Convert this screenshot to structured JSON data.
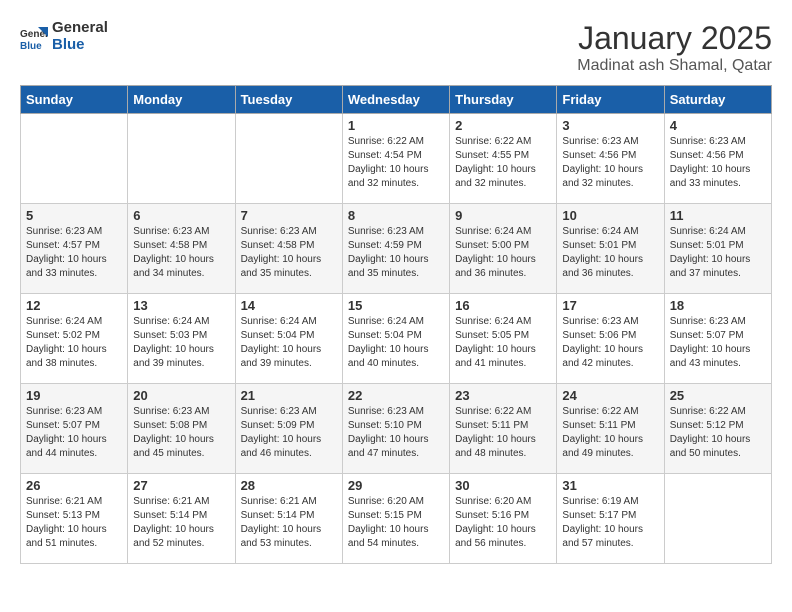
{
  "app": {
    "logo_line1": "General",
    "logo_line2": "Blue"
  },
  "header": {
    "month": "January 2025",
    "location": "Madinat ash Shamal, Qatar"
  },
  "weekdays": [
    "Sunday",
    "Monday",
    "Tuesday",
    "Wednesday",
    "Thursday",
    "Friday",
    "Saturday"
  ],
  "weeks": [
    [
      {
        "day": "",
        "sunrise": "",
        "sunset": "",
        "daylight": ""
      },
      {
        "day": "",
        "sunrise": "",
        "sunset": "",
        "daylight": ""
      },
      {
        "day": "",
        "sunrise": "",
        "sunset": "",
        "daylight": ""
      },
      {
        "day": "1",
        "sunrise": "Sunrise: 6:22 AM",
        "sunset": "Sunset: 4:54 PM",
        "daylight": "Daylight: 10 hours and 32 minutes."
      },
      {
        "day": "2",
        "sunrise": "Sunrise: 6:22 AM",
        "sunset": "Sunset: 4:55 PM",
        "daylight": "Daylight: 10 hours and 32 minutes."
      },
      {
        "day": "3",
        "sunrise": "Sunrise: 6:23 AM",
        "sunset": "Sunset: 4:56 PM",
        "daylight": "Daylight: 10 hours and 32 minutes."
      },
      {
        "day": "4",
        "sunrise": "Sunrise: 6:23 AM",
        "sunset": "Sunset: 4:56 PM",
        "daylight": "Daylight: 10 hours and 33 minutes."
      }
    ],
    [
      {
        "day": "5",
        "sunrise": "Sunrise: 6:23 AM",
        "sunset": "Sunset: 4:57 PM",
        "daylight": "Daylight: 10 hours and 33 minutes."
      },
      {
        "day": "6",
        "sunrise": "Sunrise: 6:23 AM",
        "sunset": "Sunset: 4:58 PM",
        "daylight": "Daylight: 10 hours and 34 minutes."
      },
      {
        "day": "7",
        "sunrise": "Sunrise: 6:23 AM",
        "sunset": "Sunset: 4:58 PM",
        "daylight": "Daylight: 10 hours and 35 minutes."
      },
      {
        "day": "8",
        "sunrise": "Sunrise: 6:23 AM",
        "sunset": "Sunset: 4:59 PM",
        "daylight": "Daylight: 10 hours and 35 minutes."
      },
      {
        "day": "9",
        "sunrise": "Sunrise: 6:24 AM",
        "sunset": "Sunset: 5:00 PM",
        "daylight": "Daylight: 10 hours and 36 minutes."
      },
      {
        "day": "10",
        "sunrise": "Sunrise: 6:24 AM",
        "sunset": "Sunset: 5:01 PM",
        "daylight": "Daylight: 10 hours and 36 minutes."
      },
      {
        "day": "11",
        "sunrise": "Sunrise: 6:24 AM",
        "sunset": "Sunset: 5:01 PM",
        "daylight": "Daylight: 10 hours and 37 minutes."
      }
    ],
    [
      {
        "day": "12",
        "sunrise": "Sunrise: 6:24 AM",
        "sunset": "Sunset: 5:02 PM",
        "daylight": "Daylight: 10 hours and 38 minutes."
      },
      {
        "day": "13",
        "sunrise": "Sunrise: 6:24 AM",
        "sunset": "Sunset: 5:03 PM",
        "daylight": "Daylight: 10 hours and 39 minutes."
      },
      {
        "day": "14",
        "sunrise": "Sunrise: 6:24 AM",
        "sunset": "Sunset: 5:04 PM",
        "daylight": "Daylight: 10 hours and 39 minutes."
      },
      {
        "day": "15",
        "sunrise": "Sunrise: 6:24 AM",
        "sunset": "Sunset: 5:04 PM",
        "daylight": "Daylight: 10 hours and 40 minutes."
      },
      {
        "day": "16",
        "sunrise": "Sunrise: 6:24 AM",
        "sunset": "Sunset: 5:05 PM",
        "daylight": "Daylight: 10 hours and 41 minutes."
      },
      {
        "day": "17",
        "sunrise": "Sunrise: 6:23 AM",
        "sunset": "Sunset: 5:06 PM",
        "daylight": "Daylight: 10 hours and 42 minutes."
      },
      {
        "day": "18",
        "sunrise": "Sunrise: 6:23 AM",
        "sunset": "Sunset: 5:07 PM",
        "daylight": "Daylight: 10 hours and 43 minutes."
      }
    ],
    [
      {
        "day": "19",
        "sunrise": "Sunrise: 6:23 AM",
        "sunset": "Sunset: 5:07 PM",
        "daylight": "Daylight: 10 hours and 44 minutes."
      },
      {
        "day": "20",
        "sunrise": "Sunrise: 6:23 AM",
        "sunset": "Sunset: 5:08 PM",
        "daylight": "Daylight: 10 hours and 45 minutes."
      },
      {
        "day": "21",
        "sunrise": "Sunrise: 6:23 AM",
        "sunset": "Sunset: 5:09 PM",
        "daylight": "Daylight: 10 hours and 46 minutes."
      },
      {
        "day": "22",
        "sunrise": "Sunrise: 6:23 AM",
        "sunset": "Sunset: 5:10 PM",
        "daylight": "Daylight: 10 hours and 47 minutes."
      },
      {
        "day": "23",
        "sunrise": "Sunrise: 6:22 AM",
        "sunset": "Sunset: 5:11 PM",
        "daylight": "Daylight: 10 hours and 48 minutes."
      },
      {
        "day": "24",
        "sunrise": "Sunrise: 6:22 AM",
        "sunset": "Sunset: 5:11 PM",
        "daylight": "Daylight: 10 hours and 49 minutes."
      },
      {
        "day": "25",
        "sunrise": "Sunrise: 6:22 AM",
        "sunset": "Sunset: 5:12 PM",
        "daylight": "Daylight: 10 hours and 50 minutes."
      }
    ],
    [
      {
        "day": "26",
        "sunrise": "Sunrise: 6:21 AM",
        "sunset": "Sunset: 5:13 PM",
        "daylight": "Daylight: 10 hours and 51 minutes."
      },
      {
        "day": "27",
        "sunrise": "Sunrise: 6:21 AM",
        "sunset": "Sunset: 5:14 PM",
        "daylight": "Daylight: 10 hours and 52 minutes."
      },
      {
        "day": "28",
        "sunrise": "Sunrise: 6:21 AM",
        "sunset": "Sunset: 5:14 PM",
        "daylight": "Daylight: 10 hours and 53 minutes."
      },
      {
        "day": "29",
        "sunrise": "Sunrise: 6:20 AM",
        "sunset": "Sunset: 5:15 PM",
        "daylight": "Daylight: 10 hours and 54 minutes."
      },
      {
        "day": "30",
        "sunrise": "Sunrise: 6:20 AM",
        "sunset": "Sunset: 5:16 PM",
        "daylight": "Daylight: 10 hours and 56 minutes."
      },
      {
        "day": "31",
        "sunrise": "Sunrise: 6:19 AM",
        "sunset": "Sunset: 5:17 PM",
        "daylight": "Daylight: 10 hours and 57 minutes."
      },
      {
        "day": "",
        "sunrise": "",
        "sunset": "",
        "daylight": ""
      }
    ]
  ]
}
